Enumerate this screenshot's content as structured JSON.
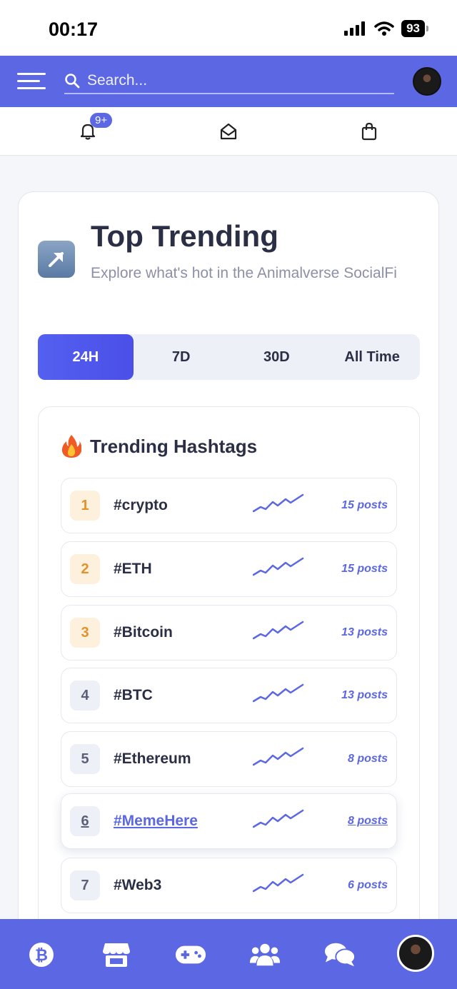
{
  "status": {
    "time": "00:17",
    "battery": "93"
  },
  "topbar": {
    "search_placeholder": "Search..."
  },
  "notifications": {
    "badge": "9+"
  },
  "page": {
    "title": "Top Trending",
    "subtitle": "Explore what's hot in the Animalverse SocialFi"
  },
  "tabs": [
    {
      "label": "24H",
      "active": true
    },
    {
      "label": "7D",
      "active": false
    },
    {
      "label": "30D",
      "active": false
    },
    {
      "label": "All Time",
      "active": false
    }
  ],
  "hashtags": {
    "title": "Trending Hashtags",
    "items": [
      {
        "rank": "1",
        "tag": "#crypto",
        "posts": "15 posts"
      },
      {
        "rank": "2",
        "tag": "#ETH",
        "posts": "15 posts"
      },
      {
        "rank": "3",
        "tag": "#Bitcoin",
        "posts": "13 posts"
      },
      {
        "rank": "4",
        "tag": "#BTC",
        "posts": "13 posts"
      },
      {
        "rank": "5",
        "tag": "#Ethereum",
        "posts": "8 posts"
      },
      {
        "rank": "6",
        "tag": "#MemeHere",
        "posts": "8 posts"
      },
      {
        "rank": "7",
        "tag": "#Web3",
        "posts": "6 posts"
      }
    ]
  },
  "colors": {
    "accent": "#5b67e3",
    "gold": "#e0922c",
    "text": "#2b2f45"
  },
  "bottom_nav": [
    "bitcoin-icon",
    "store-icon",
    "gamepad-icon",
    "users-icon",
    "chat-icon",
    "profile-avatar"
  ]
}
